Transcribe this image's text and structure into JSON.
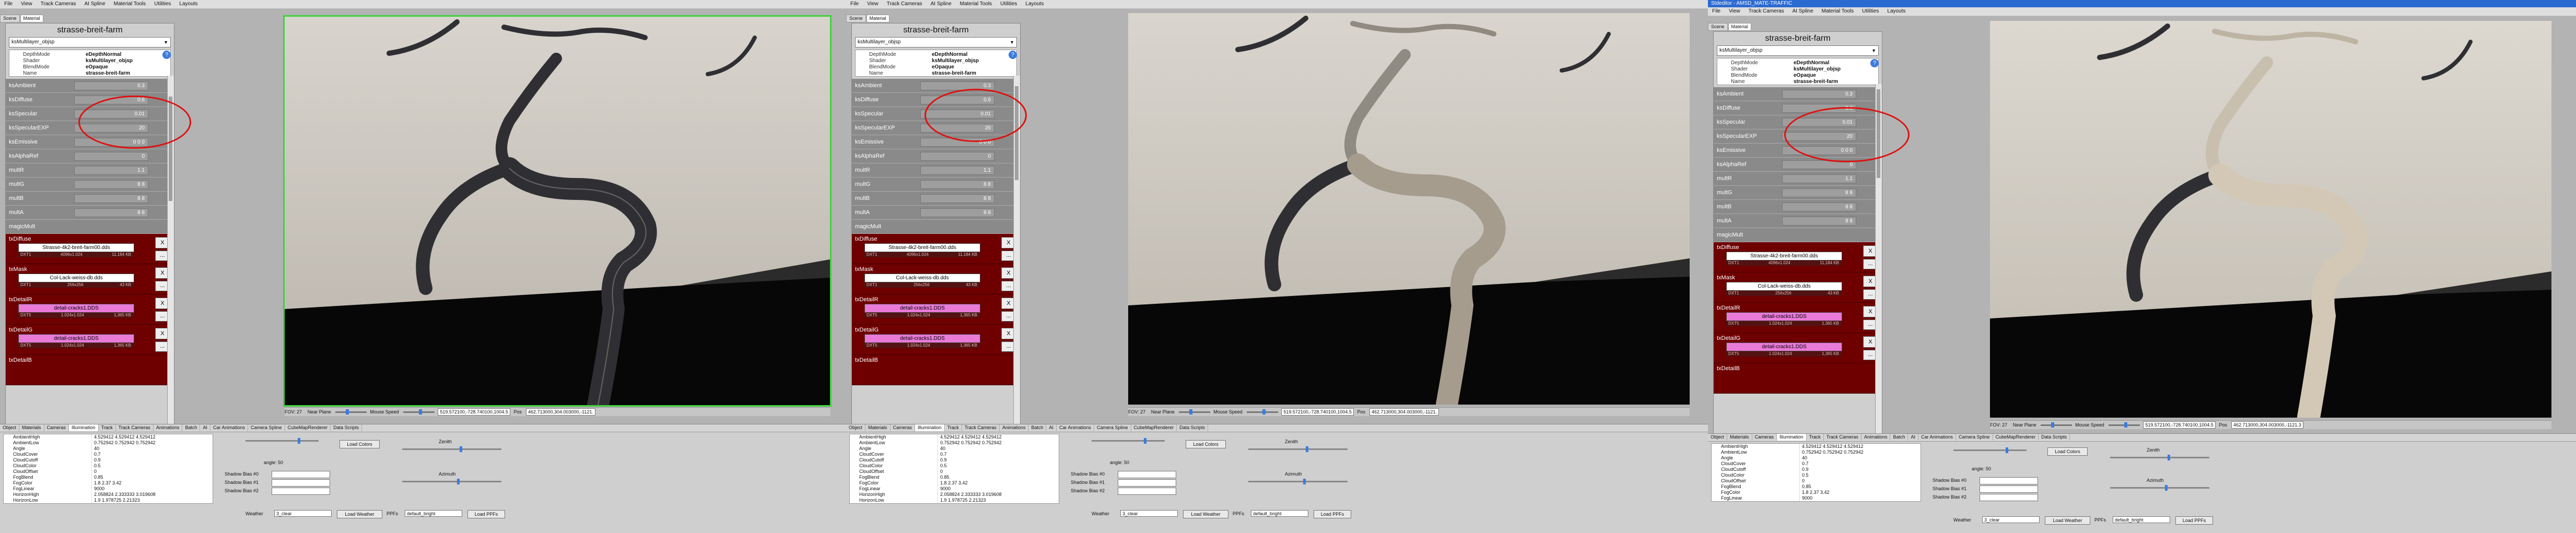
{
  "app": {
    "title": "Stdeditor - AMSD_MATE-TRAFFIC"
  },
  "menu": [
    "File",
    "View",
    "Track Cameras",
    "AI Spline",
    "Material Tools",
    "Utilities",
    "Layouts"
  ],
  "top_tabs": [
    "Scene",
    "Material"
  ],
  "material": {
    "title": "strasse-breit-farm",
    "selected": "ksMultilayer_objsp",
    "info": [
      {
        "key": "DepthMode",
        "value": "eDepthNormal"
      },
      {
        "key": "Shader",
        "value": "ksMultilayer_objsp"
      },
      {
        "key": "BlendMode",
        "value": "eOpaque"
      },
      {
        "key": "Name",
        "value": "strasse-breit-farm"
      }
    ],
    "params": [
      {
        "name": "ksAmbient",
        "value": "0.3"
      },
      {
        "name": "ksDiffuse",
        "value": "0.6"
      },
      {
        "name": "ksSpecular",
        "value": "0.01"
      },
      {
        "name": "ksSpecularEXP",
        "value": "20"
      },
      {
        "name": "ksEmissive",
        "value": "0 0 0"
      },
      {
        "name": "ksAlphaRef",
        "value": "0"
      },
      {
        "name": "multR",
        "value": "1.1"
      },
      {
        "name": "multG",
        "value": "8 8"
      },
      {
        "name": "multB",
        "value": "8 8"
      },
      {
        "name": "multA",
        "value": "8 8"
      },
      {
        "name": "magicMult",
        "value": ""
      }
    ],
    "textures": [
      {
        "slot": "txDiffuse",
        "file": "Strasse-4k2-breit-farm00.dds",
        "meta": [
          "DXT1",
          "4096x1.024",
          "11,184 KB"
        ],
        "pink": false
      },
      {
        "slot": "txMask",
        "file": "Col-Lack-weiss-db.dds",
        "meta": [
          "DXT1",
          "256x256",
          "43 KB"
        ],
        "pink": false
      },
      {
        "slot": "txDetailR",
        "file": "detail-cracks1.DDS",
        "meta": [
          "DXT5",
          "1.024x1.024",
          "1,365 KB"
        ],
        "pink": true
      },
      {
        "slot": "txDetailG",
        "file": "detail-cracks1.DDS",
        "meta": [
          "DXT5",
          "1.024x1.024",
          "1,365 KB"
        ],
        "pink": true
      },
      {
        "slot": "txDetailB",
        "file": "",
        "meta": [
          "",
          "",
          ""
        ],
        "pink": true
      }
    ],
    "x_label": "X",
    "dots_label": "..."
  },
  "status": {
    "fov_label": "FOV: 27",
    "near_plane_label": "Near Plane",
    "mouse_speed_label": "Mouse Speed",
    "coords": "519.572100,-728.740100,1004.5",
    "pos_label": "Pos",
    "pos_value": "462.713000,304.003000,-1121.",
    "pos_value_2": "462.713000,304.003000,-1121.3"
  },
  "bottom": {
    "tabs": [
      "Object",
      "Materials",
      "Cameras",
      "Illumination",
      "Track",
      "Track Cameras",
      "Animations",
      "Batch",
      "AI",
      "Car Animations",
      "Camera Spline",
      "CubeMapRenderer",
      "Data Scripts"
    ],
    "props": [
      {
        "key": "AmbientHigh",
        "value": "4.529412 4.529412 4.529412"
      },
      {
        "key": "AmbientLow",
        "value": "0.752942 0.752942 0.752942"
      },
      {
        "key": "Angle",
        "value": "40"
      },
      {
        "key": "CloudCover",
        "value": "0.7"
      },
      {
        "key": "CloudCutoff",
        "value": "0.9"
      },
      {
        "key": "CloudColor",
        "value": "0.5"
      },
      {
        "key": "CloudOffset",
        "value": "0"
      },
      {
        "key": "FogBlend",
        "value": "0.85"
      },
      {
        "key": "FogColor",
        "value": "1.8 2.37 3.42"
      },
      {
        "key": "FogLinear",
        "value": "9000"
      },
      {
        "key": "HorizonHigh",
        "value": "2.058824 2.333333 3.019608"
      },
      {
        "key": "HorizonLow",
        "value": "1.9 1.978725 2.21323"
      }
    ],
    "angle_label": "angle: 50",
    "load_colors": "Load Colors",
    "zenith": "Zenith",
    "azimuth": "Azimuth",
    "shadow_bias_0": "Shadow Bias #0",
    "shadow_bias_1": "Shadow Bias #1",
    "shadow_bias_2": "Shadow Bias #2",
    "weather_label": "Weather",
    "weather_value": "3_clear",
    "load_weather": "Load Weather",
    "ppf_label": "PPFs",
    "ppf_value": "default_bright",
    "load_ppfs": "Load PPFs"
  },
  "colors": {
    "highlight": "#d11111",
    "active_outline": "#3fd23f",
    "texture_bg": "#6e0000",
    "pink": "#ea7ad8"
  }
}
